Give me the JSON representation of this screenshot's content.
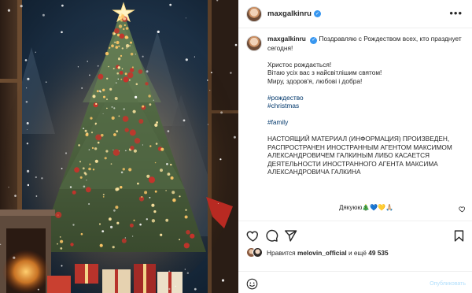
{
  "post": {
    "username": "maxgalkinru",
    "verified_mark": "✓",
    "more_icon": "•••",
    "caption": {
      "username": "maxgalkinru",
      "lead": "Поздравляю с Рождеством всех, кто празднует сегодня!",
      "ua_lines": [
        "Христос рождається!",
        "Вітаю усіх вас з найсвітлішим святом!",
        "Миру, здоров'я, любові і добра!"
      ],
      "hashtags": [
        "#рождество",
        "#christmas"
      ],
      "hashtag2": "#family",
      "disclaimer": "НАСТОЯЩИЙ МАТЕРИАЛ (ИНФОРМАЦИЯ) ПРОИЗВЕДЕН, РАСПРОСТРАНЕН ИНОСТРАННЫМ АГЕНТОМ МАКСИМОМ АЛЕКСАНДРОВИЧЕМ ГАЛКИНЫМ ЛИБО КАСАЕТСЯ ДЕЯТЕЛЬНОСТИ ИНОСТРАННОГО АГЕНТА МАКСИМА АЛЕКСАНДРОВИЧА ГАЛКИНА"
    },
    "comment": {
      "text": "Дякуюю🎄💙💛🙏🏼"
    },
    "likes": {
      "prefix": "Нравится",
      "user": "melovin_official",
      "and_more": "и ещё",
      "count": "49 535"
    },
    "add_comment": {
      "publish_label": "Опубликовать"
    }
  },
  "icons": {
    "more": "more-options-icon",
    "verified": "verified-badge-icon",
    "like": "heart-icon",
    "comment": "comment-bubble-icon",
    "share": "paper-plane-icon",
    "save": "bookmark-icon",
    "emoji": "smiley-icon"
  },
  "colors": {
    "hashtag": "#00376b",
    "verified": "#3897f0",
    "publish_disabled": "#b2dffc"
  }
}
